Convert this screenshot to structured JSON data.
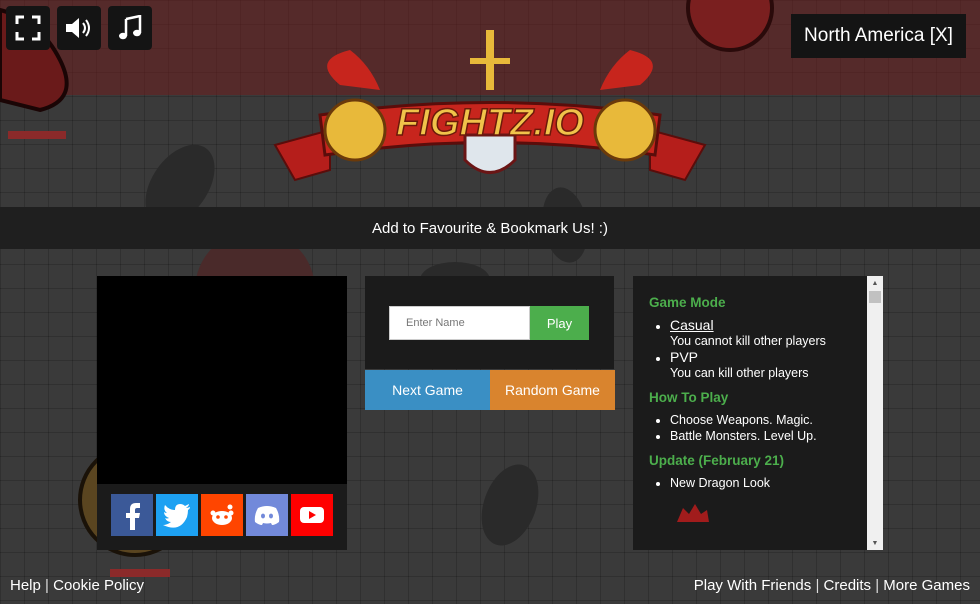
{
  "app": {
    "brand": "FIGHTZ.IO"
  },
  "toolbar": {
    "fullscreen_icon": "fullscreen-icon",
    "sound_icon": "speaker-icon",
    "music_icon": "music-note-icon"
  },
  "region": {
    "label": "North America [X]"
  },
  "banner": {
    "text": "Add to Favourite & Bookmark Us! :)"
  },
  "play_form": {
    "name_placeholder": "Enter Name",
    "name_value": "",
    "play_label": "Play",
    "next_game_label": "Next Game",
    "random_game_label": "Random Game"
  },
  "social": [
    {
      "name": "facebook-icon",
      "color": "#3b5998"
    },
    {
      "name": "twitter-icon",
      "color": "#1da1f2"
    },
    {
      "name": "reddit-icon",
      "color": "#ff4500"
    },
    {
      "name": "discord-icon",
      "color": "#7289da"
    },
    {
      "name": "youtube-icon",
      "color": "#ff0000"
    }
  ],
  "info": {
    "game_mode_title": "Game Mode",
    "modes": [
      {
        "name": "Casual",
        "desc": "You cannot kill other players"
      },
      {
        "name": "PVP",
        "desc": "You can kill other players"
      }
    ],
    "how_to_play_title": "How To Play",
    "how_to_play": [
      "Choose Weapons. Magic.",
      "Battle Monsters. Level Up."
    ],
    "update_title": "Update (February 21)",
    "updates": [
      "New Dragon Look"
    ]
  },
  "footer": {
    "help": "Help",
    "sep1": "|",
    "cookie": "Cookie Policy",
    "play_friends": "Play With Friends",
    "sep2": "|",
    "credits": "Credits",
    "sep3": "|",
    "more_games": "More Games"
  },
  "colors": {
    "accent_green": "#4cae4c",
    "next_blue": "#3a8fc4",
    "random_orange": "#d9842e",
    "panel": "#1b1b1b"
  }
}
